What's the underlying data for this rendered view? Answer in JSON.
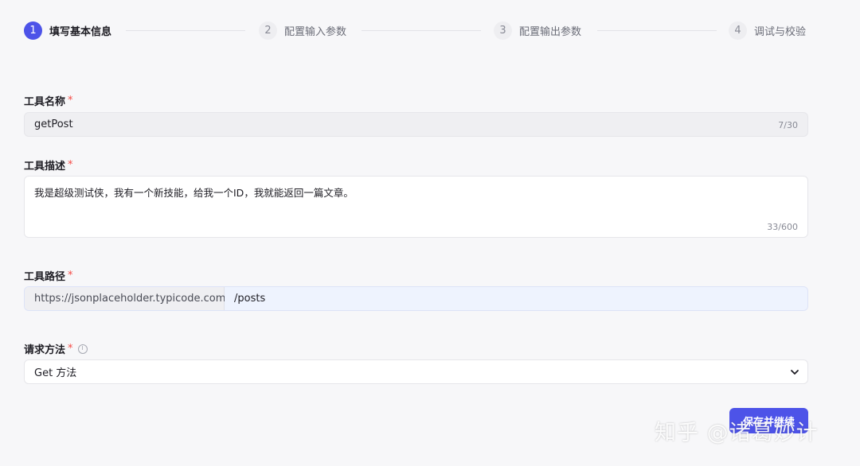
{
  "stepper": {
    "steps": [
      {
        "number": "1",
        "label": "填写基本信息",
        "active": true
      },
      {
        "number": "2",
        "label": "配置输入参数",
        "active": false
      },
      {
        "number": "3",
        "label": "配置输出参数",
        "active": false
      },
      {
        "number": "4",
        "label": "调试与校验",
        "active": false
      }
    ]
  },
  "form": {
    "tool_name": {
      "label": "工具名称",
      "required_mark": "*",
      "value": "getPost",
      "counter": "7/30"
    },
    "tool_description": {
      "label": "工具描述",
      "required_mark": "*",
      "value": "我是超级测试侠，我有一个新技能，给我一个ID，我就能返回一篇文章。",
      "counter": "33/600"
    },
    "tool_path": {
      "label": "工具路径",
      "required_mark": "*",
      "prefix": "https://jsonplaceholder.typicode.com",
      "value": "/posts"
    },
    "request_method": {
      "label": "请求方法",
      "required_mark": "*",
      "info_icon": "ⓘ",
      "selected": "Get 方法"
    }
  },
  "actions": {
    "next_label": "保存并继续"
  },
  "watermark": "知乎 @诸葛妙计",
  "colors": {
    "primary": "#4d53e8",
    "required": "#f54a45",
    "background": "#f7f7f9"
  }
}
